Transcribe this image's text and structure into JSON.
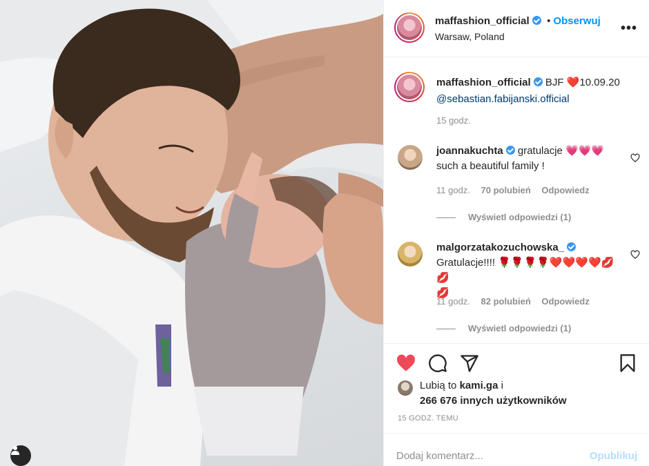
{
  "post": {
    "username": "maffashion_official",
    "follow_label": "Obserwuj",
    "separator": "•",
    "location": "Warsaw, Poland",
    "more_label": "•••"
  },
  "caption": {
    "username": "maffashion_official",
    "text_before": "BJF",
    "emoji": "❤️",
    "text_after": "10.09.20",
    "mention": "@sebastian.fabijanski.official",
    "time": "15 godz."
  },
  "comments": [
    {
      "username": "joannakuchta",
      "text": "gratulacje 💗💗💗",
      "text2": "such a beautiful family !",
      "time": "11 godz.",
      "likes": "70 polubień",
      "reply_label": "Odpowiedz",
      "view_replies": "Wyświetl odpowiedzi (1)"
    },
    {
      "username": "malgorzatakozuchowska_",
      "text": "Gratulacje!!!! 🌹🌹🌹🌹❤️❤️❤️❤️💋💋",
      "text2": "💋",
      "time": "11 godz.",
      "likes": "82 polubień",
      "reply_label": "Odpowiedz",
      "view_replies": "Wyświetl odpowiedzi (1)"
    }
  ],
  "likes": {
    "prefix": "Lubią to",
    "user": "kami.ga",
    "conj": "i",
    "count": "266 676 innych użytkowników"
  },
  "timestamp": "15 GODZ. TEMU",
  "add_comment": {
    "placeholder": "Dodaj komentarz...",
    "publish_label": "Opublikuj"
  },
  "colors": {
    "like_active": "#ed4956",
    "link": "#0095f6",
    "verified": "#3897f0",
    "muted": "#8e8e8e",
    "publish_disabled": "#b2dffc"
  },
  "icons": [
    "verified-badge-icon",
    "heart-filled-icon",
    "comment-icon",
    "share-icon",
    "bookmark-icon",
    "heart-outline-icon",
    "user-tag-icon"
  ]
}
